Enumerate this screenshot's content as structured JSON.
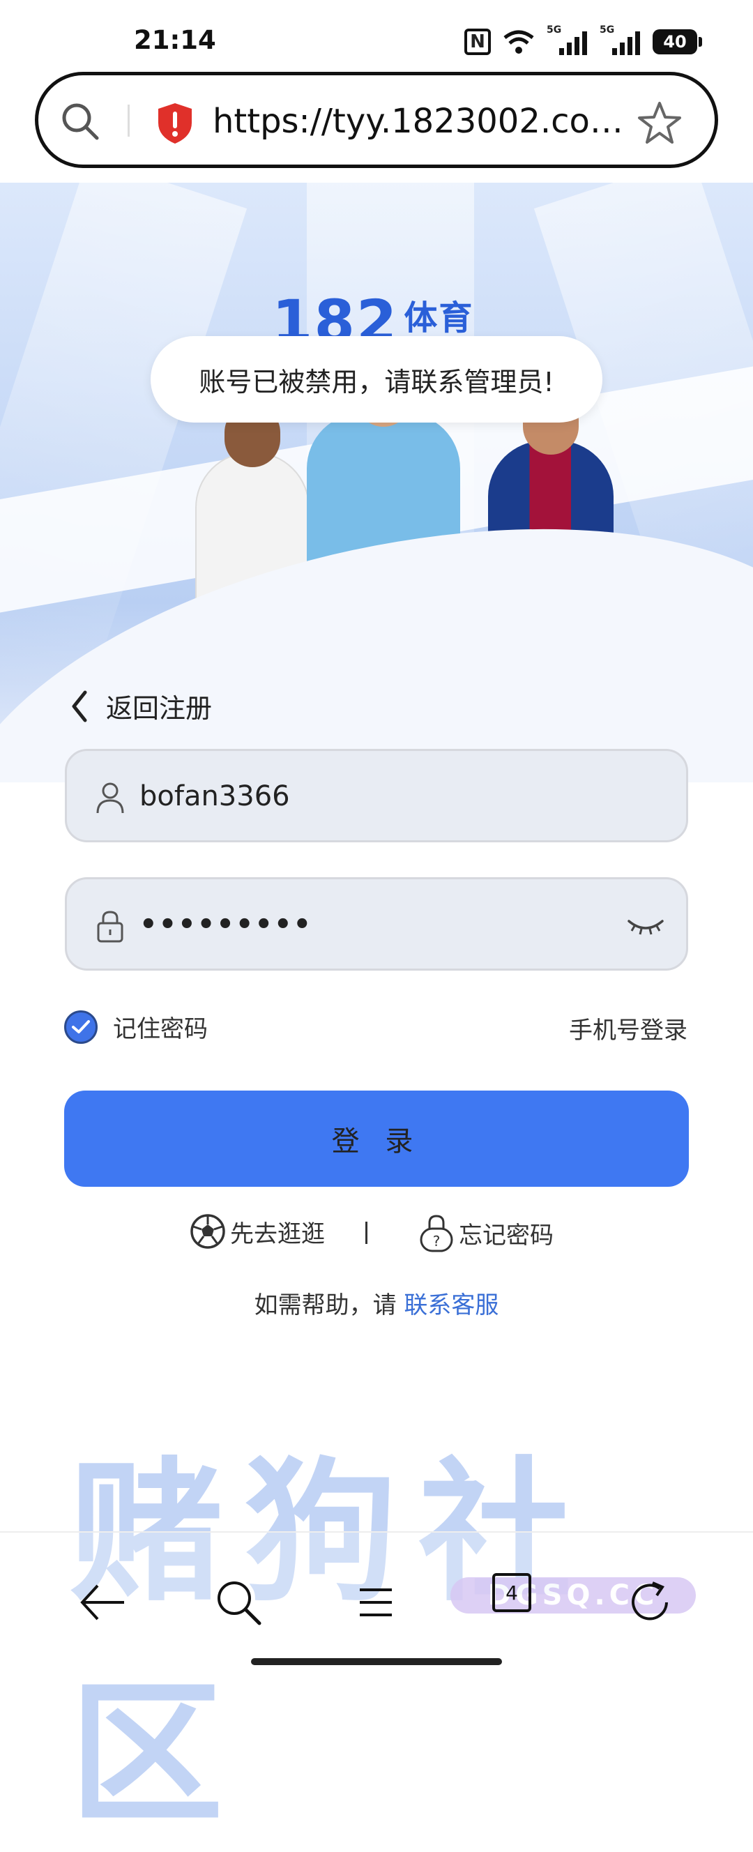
{
  "status_bar": {
    "time": "21:14",
    "nfc": "N",
    "signal1": "5G",
    "signal2": "5G",
    "battery": "40"
  },
  "browser": {
    "url": "https://tyy.1823002.com..."
  },
  "hero": {
    "logo_number": "182",
    "logo_text": "体育"
  },
  "toast": {
    "message": "账号已被禁用，请联系管理员!"
  },
  "form": {
    "back_label": "返回注册",
    "username_value": "bofan3366",
    "password_value": "•••••••••",
    "remember_label": "记住密码",
    "phone_login_label": "手机号登录",
    "login_button_label": "登 录",
    "browse_label": "先去逛逛",
    "separator": "|",
    "forgot_label": "忘记密码",
    "help_prefix": "如需帮助，请",
    "help_link": "联系客服"
  },
  "watermark": {
    "text": "赌狗社区",
    "domain": "DGSQ.CC"
  },
  "bottom_nav": {
    "tab_count": "4"
  },
  "colors": {
    "accent": "#3f78f2",
    "link": "#3a6fd6",
    "field_bg": "#e8ecf3"
  }
}
